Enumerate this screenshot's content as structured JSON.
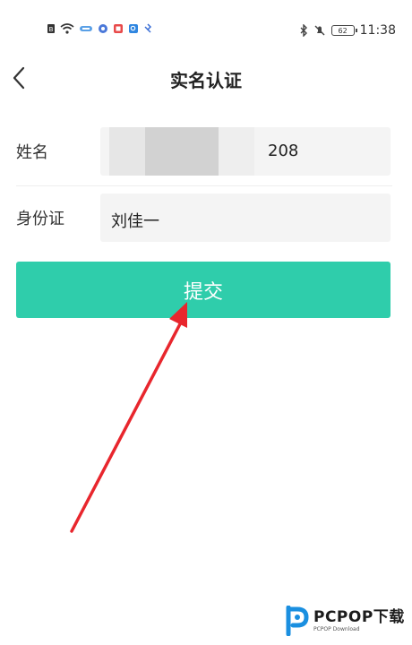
{
  "status_bar": {
    "time": "11:38",
    "battery_level": "62",
    "left_icons": [
      "sim-icon",
      "wifi-icon",
      "app-icon",
      "app-icon",
      "app-icon",
      "app-icon",
      "app-icon"
    ],
    "right_icons": [
      "bluetooth-icon",
      "mute-icon",
      "battery-icon"
    ]
  },
  "nav": {
    "title": "实名认证",
    "back_icon": "chevron-left-icon"
  },
  "form": {
    "name_label": "姓名",
    "name_value_visible": "208",
    "id_label": "身份证",
    "id_value": "刘佳一"
  },
  "submit_label": "提交",
  "watermark": {
    "main": "PCPOP下载",
    "sub": "PCPOP Download"
  },
  "colors": {
    "accent": "#2fcdab",
    "arrow": "#e8262d",
    "input_bg": "#f4f4f4"
  }
}
